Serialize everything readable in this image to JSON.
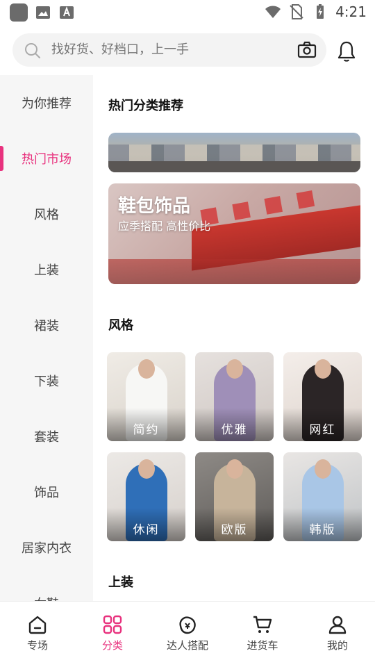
{
  "status_bar": {
    "time": "4:21"
  },
  "search": {
    "placeholder": "找好货、好档口，上一手"
  },
  "sidebar": {
    "items": [
      {
        "label": "为你推荐",
        "active": false
      },
      {
        "label": "热门市场",
        "active": true
      },
      {
        "label": "风格",
        "active": false
      },
      {
        "label": "上装",
        "active": false
      },
      {
        "label": "裙装",
        "active": false
      },
      {
        "label": "下装",
        "active": false
      },
      {
        "label": "套装",
        "active": false
      },
      {
        "label": "饰品",
        "active": false
      },
      {
        "label": "居家内衣",
        "active": false
      },
      {
        "label": "女鞋",
        "active": false
      }
    ]
  },
  "main": {
    "hot_title": "热门分类推荐",
    "banner": {
      "title": "鞋包饰品",
      "subtitle": "应季搭配 高性价比"
    },
    "style_title": "风格",
    "styles": [
      {
        "label": "简约"
      },
      {
        "label": "优雅"
      },
      {
        "label": "网红"
      },
      {
        "label": "休闲"
      },
      {
        "label": "欧版"
      },
      {
        "label": "韩版"
      }
    ],
    "tops_title": "上装"
  },
  "tabbar": {
    "tabs": [
      {
        "label": "专场",
        "active": false
      },
      {
        "label": "分类",
        "active": true
      },
      {
        "label": "达人搭配",
        "active": false
      },
      {
        "label": "进货车",
        "active": false
      },
      {
        "label": "我的",
        "active": false
      }
    ]
  },
  "colors": {
    "accent": "#e8327e",
    "sidebar_bg": "#f6f6f6",
    "search_bg": "#f3f3f3"
  }
}
